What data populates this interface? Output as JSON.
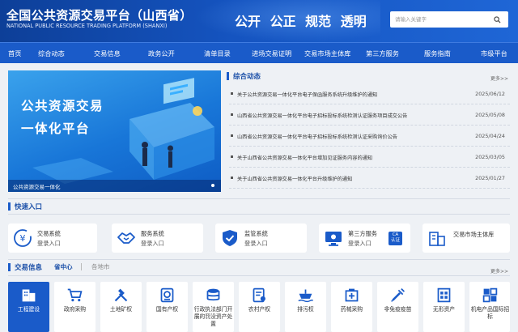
{
  "header": {
    "title": "全国公共资源交易平台（山西省）",
    "subtitle": "NATIONAL PUBLIC RESOURCE TRADING PLATFORM (SHANXI)",
    "slogan": "公开 公正 规范 透明",
    "search_placeholder": "请输入关键字"
  },
  "nav": {
    "items": [
      "首页",
      "综合动态",
      "交易信息",
      "政务公开",
      "清单目录",
      "进场交易证明",
      "交易市场主体库",
      "第三方服务",
      "服务指南",
      "市级平台"
    ]
  },
  "banner": {
    "headline_line1": "公共资源交易",
    "headline_line2": "一体化平台",
    "caption": "公共资源交易一体化"
  },
  "news": {
    "title": "综合动态",
    "more": "更多>>",
    "items": [
      {
        "title": "关于公共资源交易一体化平台电子保函服务系统升级维护的通知",
        "date": "2025/06/12"
      },
      {
        "title": "山西省公共资源交易一体化平台电子招标投标系统检测认证服务项目成交公告",
        "date": "2025/05/08"
      },
      {
        "title": "山西省公共资源交易一体化平台电子招标投标系统检测认证采购询价公告",
        "date": "2025/04/24"
      },
      {
        "title": "关于山西省公共资源交易一体化平台增加见证服务内容的通知",
        "date": "2025/03/05"
      },
      {
        "title": "关于山西省公共资源交易一体化平台升级维护的通知",
        "date": "2025/01/27"
      }
    ]
  },
  "quick": {
    "title": "快速入口",
    "cards": [
      {
        "l1": "交易系统",
        "l2": "登录入口",
        "icon": "transaction-system-icon"
      },
      {
        "l1": "服务系统",
        "l2": "登录入口",
        "icon": "handshake-icon"
      },
      {
        "l1": "监管系统",
        "l2": "登录入口",
        "icon": "shield-check-icon"
      },
      {
        "l1": "第三方服务",
        "l2": "登录入口",
        "icon": "third-party-screen-icon",
        "badge_top": "CA",
        "badge_bottom": "认证"
      },
      {
        "l1": "交易市场主体库",
        "l2": "",
        "icon": "building-icon"
      }
    ]
  },
  "trade": {
    "title": "交易信息",
    "tab_active": "省中心",
    "tab_inactive": "各地市",
    "more": "更多>>",
    "tiles": [
      {
        "label": "工程建设",
        "icon": "building-icon",
        "active": true
      },
      {
        "label": "政府采购",
        "icon": "cart-icon",
        "active": false
      },
      {
        "label": "土地矿权",
        "icon": "tools-icon",
        "active": false
      },
      {
        "label": "国有产权",
        "icon": "property-icon",
        "active": false
      },
      {
        "label": "行政执法部门开展的罚没资产处置",
        "icon": "coins-icon",
        "active": false
      },
      {
        "label": "农村产权",
        "icon": "rural-icon",
        "active": false
      },
      {
        "label": "排污权",
        "icon": "emission-icon",
        "active": false
      },
      {
        "label": "药械采购",
        "icon": "medicine-icon",
        "active": false
      },
      {
        "label": "非免疫疫苗",
        "icon": "vaccine-icon",
        "active": false
      },
      {
        "label": "无形资产",
        "icon": "intangible-icon",
        "active": false
      },
      {
        "label": "机电产品国际招标",
        "icon": "machinery-icon",
        "active": false
      }
    ]
  },
  "colors": {
    "primary": "#1a5bc9",
    "nav": "#1a5bc9",
    "header_dark": "#0d3f98",
    "text": "#333333",
    "bg": "#eef1f5"
  }
}
